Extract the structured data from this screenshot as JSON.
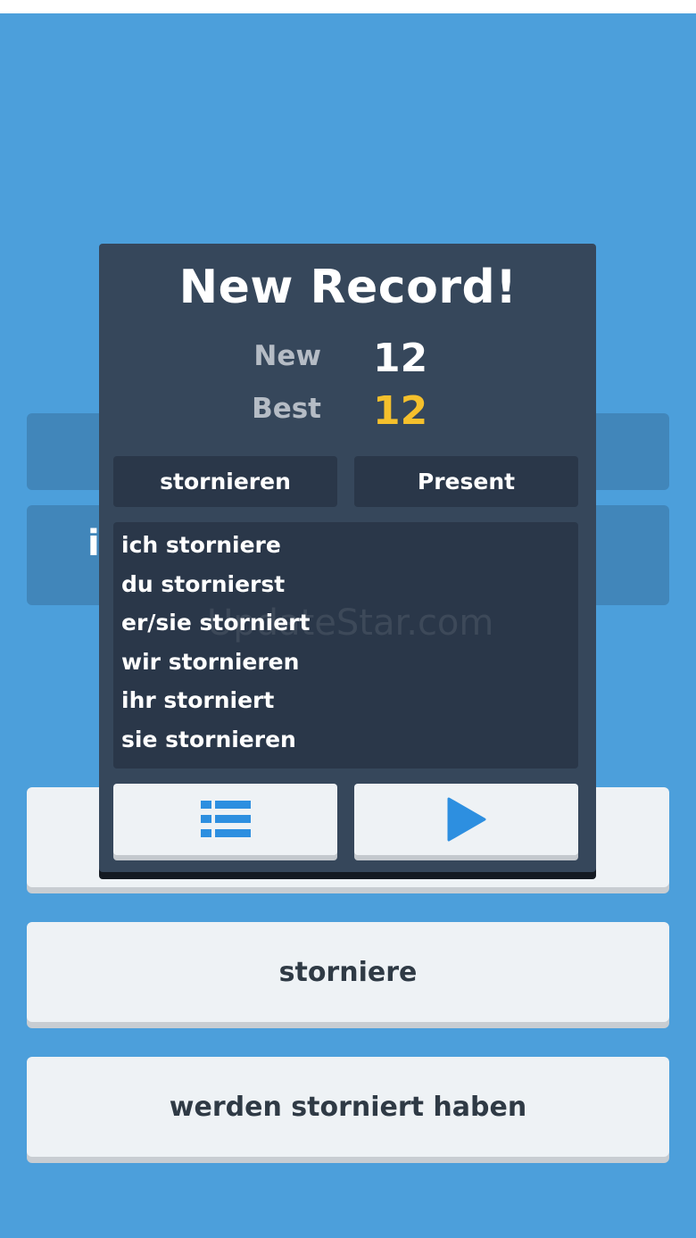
{
  "modal": {
    "title": "New Record!",
    "new_label": "New",
    "new_value": "12",
    "best_label": "Best",
    "best_value": "12",
    "verb": "stornieren",
    "tense": "Present",
    "conjugations": [
      "ich storniere",
      "du stornierst",
      "er/sie storniert",
      "wir stornieren",
      "ihr storniert",
      "sie stornieren"
    ],
    "list_icon": "list-icon",
    "play_icon": "play-icon"
  },
  "background": {
    "partial_letter": "i"
  },
  "answers": [
    "",
    "storniere",
    "werden storniert haben"
  ],
  "watermark": "UpdateStar.com",
  "colors": {
    "background": "#4c9fdb",
    "modal": "#36475b",
    "accent_gold": "#f5c02c",
    "icon_blue": "#2d8fe0"
  }
}
